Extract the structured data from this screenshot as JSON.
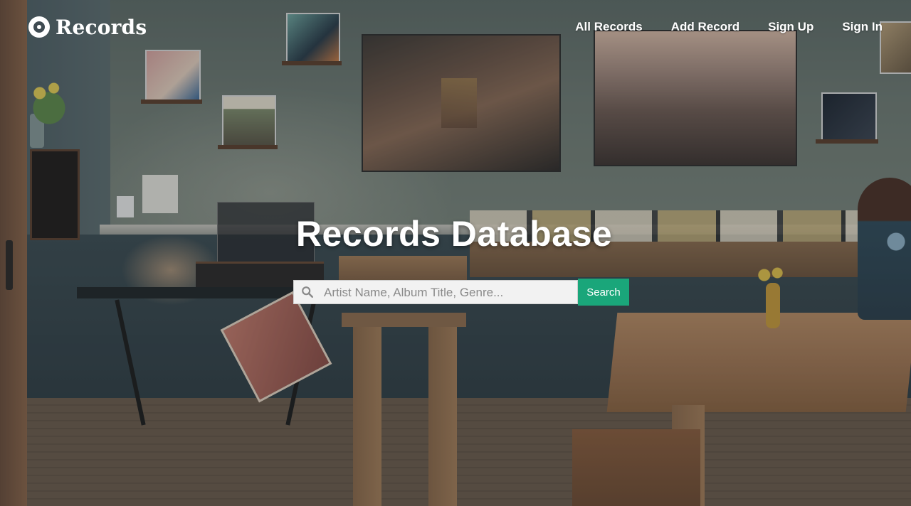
{
  "brand": {
    "logo_icon": "vinyl-record-icon",
    "name": "Records"
  },
  "nav": {
    "items": [
      {
        "label": "All Records"
      },
      {
        "label": "Add Record"
      },
      {
        "label": "Sign Up"
      },
      {
        "label": "Sign In"
      }
    ]
  },
  "hero": {
    "title": "Records Database"
  },
  "search": {
    "icon": "search-icon",
    "value": "",
    "placeholder": "Artist Name, Album Title, Genre...",
    "button_label": "Search"
  },
  "colors": {
    "accent": "#1aa67a",
    "text_on_image": "#ffffff"
  }
}
